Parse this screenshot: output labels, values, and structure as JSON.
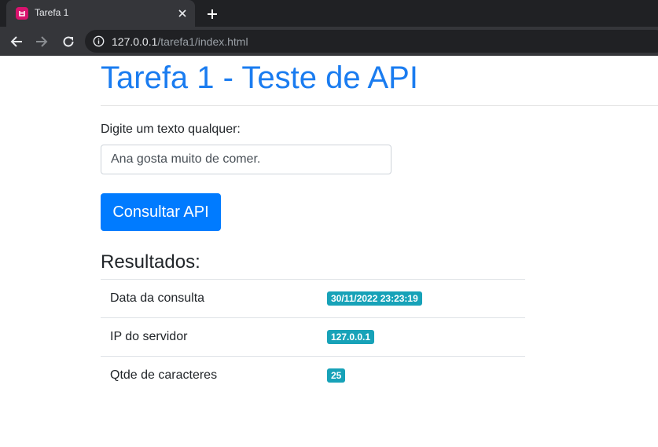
{
  "browser": {
    "tab_title": "Tarefa 1",
    "url_host": "127.0.0.1",
    "url_path": "/tarefa1/index.html"
  },
  "page": {
    "title": "Tarefa 1 - Teste de API",
    "input_label": "Digite um texto qualquer:",
    "input_value": "Ana gosta muito de comer.",
    "button_label": "Consultar API",
    "results_heading": "Resultados:",
    "results": [
      {
        "label": "Data da consulta",
        "value": "30/11/2022 23:23:19"
      },
      {
        "label": "IP do servidor",
        "value": "127.0.0.1"
      },
      {
        "label": "Qtde de caracteres",
        "value": "25"
      }
    ]
  },
  "colors": {
    "primary": "#007bff",
    "title": "#1a7cf0",
    "badge": "#17a2b8",
    "favicon": "#d8136e"
  }
}
